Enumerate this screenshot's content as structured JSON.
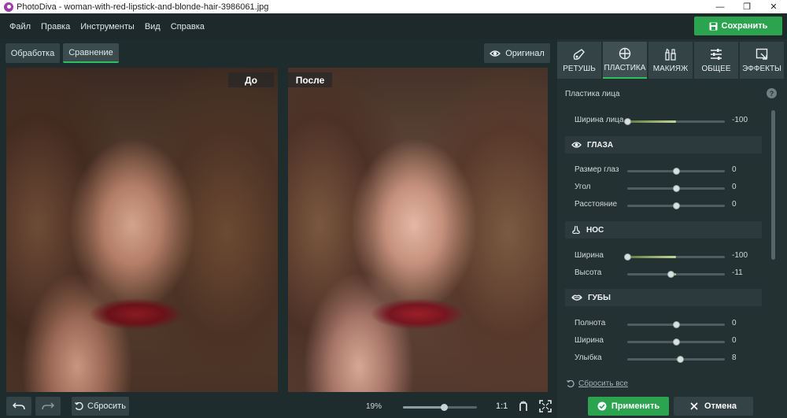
{
  "window": {
    "title": "PhotoDiva - woman-with-red-lipstick-and-blonde-hair-3986061.jpg",
    "minimize": "—",
    "restore": "❐",
    "close": "✕"
  },
  "menu": [
    "Файл",
    "Правка",
    "Инструменты",
    "Вид",
    "Справка"
  ],
  "save_label": "Сохранить",
  "view_tabs": [
    "Обработка",
    "Сравнение"
  ],
  "active_view_tab": "Сравнение",
  "original_label": "Оригинал",
  "photo_labels": {
    "before": "До",
    "after": "После"
  },
  "panel_tabs": [
    "РЕТУШЬ",
    "ПЛАСТИКА",
    "МАКИЯЖ",
    "ОБЩЕЕ",
    "ЭФФЕКТЫ"
  ],
  "active_panel_tab": "ПЛАСТИКА",
  "section_title": "Пластика лица",
  "face_width": {
    "label": "Ширина лица",
    "value": "-100",
    "level": 0.0
  },
  "groups": {
    "eyes": {
      "title": "ГЛАЗА",
      "sliders": [
        {
          "label": "Размер глаз",
          "value": "0",
          "level": 0.5
        },
        {
          "label": "Угол",
          "value": "0",
          "level": 0.5
        },
        {
          "label": "Расстояние",
          "value": "0",
          "level": 0.5
        }
      ]
    },
    "nose": {
      "title": "НОС",
      "sliders": [
        {
          "label": "Ширина",
          "value": "-100",
          "level": 0.0
        },
        {
          "label": "Высота",
          "value": "-11",
          "level": 0.445
        }
      ]
    },
    "lips": {
      "title": "ГУБЫ",
      "sliders": [
        {
          "label": "Полнота",
          "value": "0",
          "level": 0.5
        },
        {
          "label": "Ширина",
          "value": "0",
          "level": 0.5
        },
        {
          "label": "Улыбка",
          "value": "8",
          "level": 0.54
        }
      ]
    }
  },
  "reset_all_label": "Сбросить все",
  "apply_label": "Применить",
  "cancel_label": "Отмена",
  "reset_label": "Сбросить",
  "zoom": {
    "percent": "19%",
    "level": 0.55,
    "one_to_one": "1:1"
  },
  "colors": {
    "accent": "#2ba34f",
    "panel": "#243133",
    "button": "#344346"
  }
}
